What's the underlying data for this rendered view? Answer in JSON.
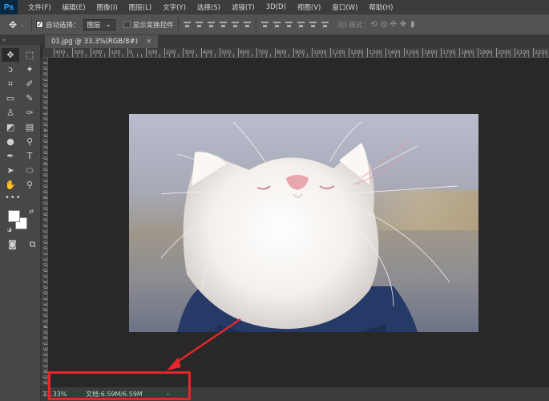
{
  "app": {
    "logo": "Ps"
  },
  "menubar": {
    "items": [
      "文件(F)",
      "编辑(E)",
      "图像(I)",
      "图层(L)",
      "文字(Y)",
      "选择(S)",
      "滤镜(T)",
      "3D(D)",
      "视图(V)",
      "窗口(W)",
      "帮助(H)"
    ]
  },
  "options": {
    "auto_select_label": "自动选择：",
    "auto_select_checked": true,
    "layer_select_value": "图层",
    "show_transform_label": "显示变换控件",
    "show_transform_checked": false,
    "mode_3d_label": "3D 模式："
  },
  "panel_strip": {
    "label": "«"
  },
  "document": {
    "tab_title": "01.jpg @ 33.3%(RGB/8#)",
    "close_glyph": "×"
  },
  "ruler": {
    "top_labels": [
      "400",
      "300",
      "200",
      "100",
      "0",
      "100",
      "200",
      "300",
      "400",
      "500",
      "600",
      "700",
      "800",
      "900",
      "1000",
      "1100",
      "1200",
      "1300",
      "1400",
      "1500",
      "1600",
      "1700",
      "1800",
      "1900",
      "2000",
      "2100",
      "2200"
    ],
    "left_labels": [
      "1",
      "0",
      "0",
      "1",
      "0",
      "0",
      "2",
      "0",
      "0",
      "3",
      "0",
      "0",
      "4",
      "0",
      "0",
      "5",
      "0",
      "0",
      "6",
      "0",
      "0",
      "7",
      "0",
      "0",
      "8",
      "0",
      "0",
      "9",
      "0",
      "0",
      "1",
      "0",
      "0",
      "0",
      "1",
      "1",
      "0",
      "0",
      "1",
      "2",
      "0",
      "0",
      "1",
      "3",
      "0",
      "0",
      "1",
      "4",
      "0",
      "0",
      "1",
      "5",
      "0",
      "0",
      "1",
      "6",
      "0",
      "0"
    ]
  },
  "tools": [
    {
      "icon": "move-icon",
      "glyph": "✥",
      "active": true
    },
    {
      "icon": "marquee-icon",
      "glyph": "⬚"
    },
    {
      "icon": "lasso-icon",
      "glyph": "ↄ"
    },
    {
      "icon": "magic-wand-icon",
      "glyph": "✦"
    },
    {
      "icon": "crop-icon",
      "glyph": "⌗"
    },
    {
      "icon": "eyedropper-icon",
      "glyph": "✐"
    },
    {
      "icon": "healing-icon",
      "glyph": "▭"
    },
    {
      "icon": "brush-icon",
      "glyph": "✎"
    },
    {
      "icon": "stamp-icon",
      "glyph": "♙"
    },
    {
      "icon": "history-brush-icon",
      "glyph": "✑"
    },
    {
      "icon": "eraser-icon",
      "glyph": "◩"
    },
    {
      "icon": "gradient-icon",
      "glyph": "▤"
    },
    {
      "icon": "blur-icon",
      "glyph": "●"
    },
    {
      "icon": "dodge-icon",
      "glyph": "⚲"
    },
    {
      "icon": "pen-icon",
      "glyph": "✒"
    },
    {
      "icon": "type-icon",
      "glyph": "T"
    },
    {
      "icon": "path-select-icon",
      "glyph": "➤"
    },
    {
      "icon": "shape-icon",
      "glyph": "⬭"
    },
    {
      "icon": "hand-icon",
      "glyph": "✋"
    },
    {
      "icon": "zoom-icon",
      "glyph": "⚲"
    }
  ],
  "toolbar_extra": {
    "dots": "•••"
  },
  "colors": {
    "foreground": "#ffffff",
    "background": "#ffffff"
  },
  "status": {
    "zoom": "33.33%",
    "doc_size": "文档:6.59M/6.59M",
    "arrow": "›"
  },
  "annotation": {
    "color": "#e3272b"
  }
}
